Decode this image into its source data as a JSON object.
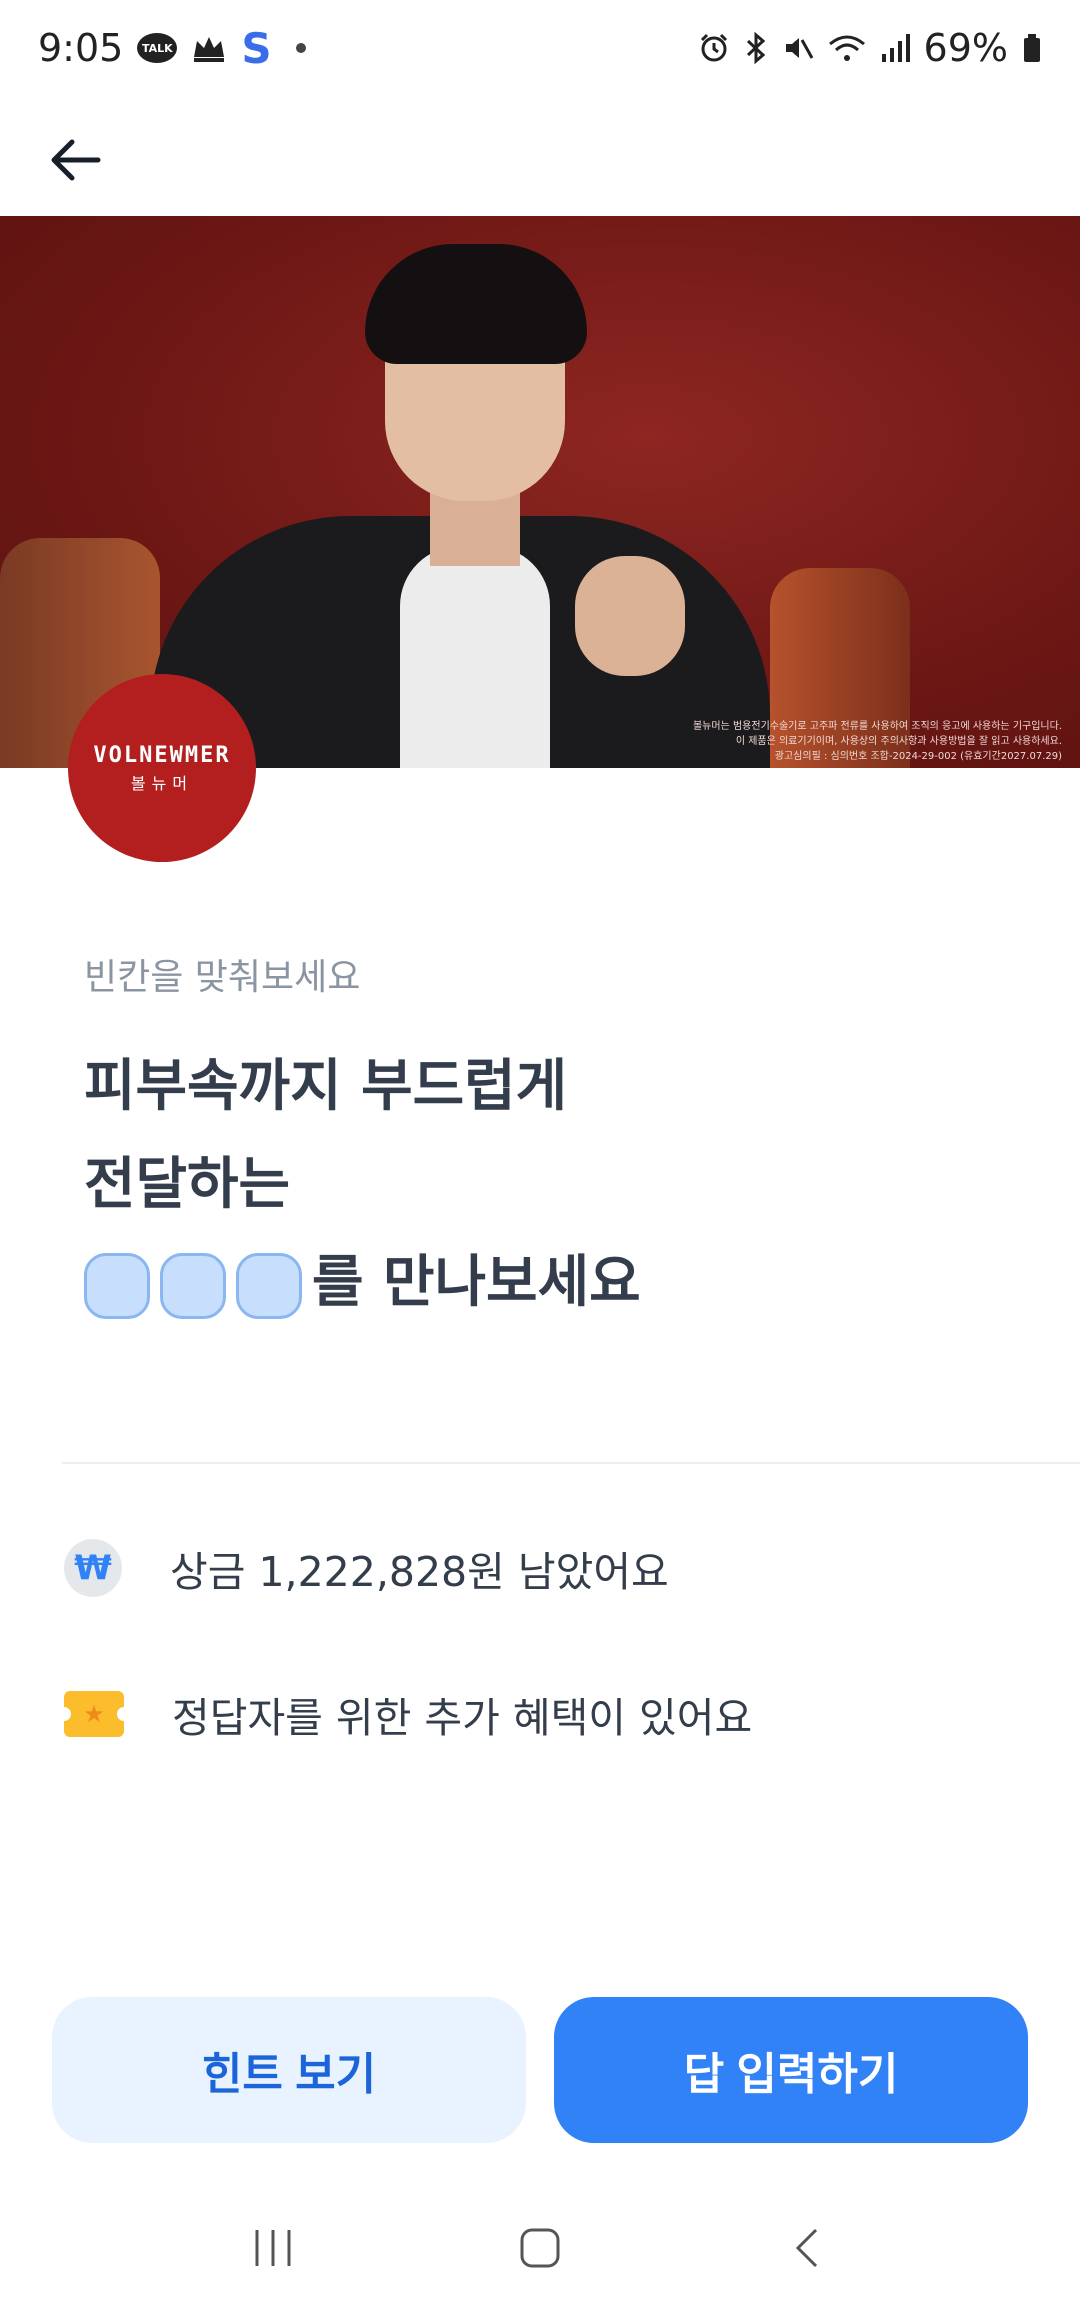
{
  "status_bar": {
    "time": "9:05",
    "talk_label": "TALK",
    "s_label": "S",
    "battery": "69%"
  },
  "banner": {
    "fine_print": [
      "볼뉴머는 범용전기수술기로 고주파 전류를 사용하여 조직의 응고에 사용하는 기구입니다.",
      "이 제품은 의료기기이며, 사용상의 주의사항과 사용방법을 잘 읽고 사용하세요.",
      "광고심의필 : 심의번호 조합-2024-29-002 (유효기간2027.07.29)"
    ]
  },
  "brand": {
    "name_en": "VOLNEWMER",
    "name_ko": "볼뉴머"
  },
  "quiz": {
    "instruction": "빈칸을 맞춰보세요",
    "line1": "피부속까지 부드럽게",
    "line2": "전달하는",
    "line3_suffix": "를 만나보세요",
    "blank_count": 3
  },
  "info": {
    "prize_icon": "₩",
    "prize_text": "상금 1,222,828원 남았어요",
    "bonus_icon": "★",
    "bonus_text": "정답자를 위한 추가 혜택이 있어요"
  },
  "buttons": {
    "hint": "힌트 보기",
    "answer": "답 입력하기"
  },
  "colors": {
    "accent": "#3182f6",
    "hint_bg": "#e8f3ff",
    "brand_red": "#b31f1f",
    "banner_red": "#7a1a17"
  }
}
